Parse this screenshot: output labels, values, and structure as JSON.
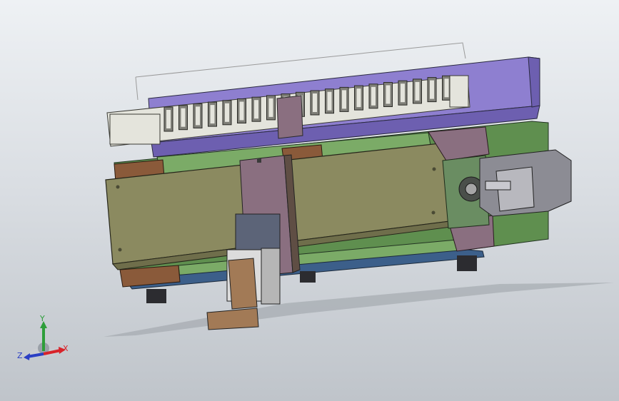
{
  "viewport": {
    "background_top": "#eef1f4",
    "background_bottom": "#bfc4ca"
  },
  "model": {
    "colors": {
      "purple_plate": "#8e7fd0",
      "purple_dark": "#6d5fb0",
      "chain": "#e4e4dc",
      "chain_dark": "#7f7f78",
      "olive_body": "#8b8a60",
      "olive_dark": "#6f6e4b",
      "green_plate": "#5f8f4f",
      "green_light": "#7bab67",
      "brown": "#8a5a3a",
      "mauve_bracket": "#8a6f80",
      "motor_grey": "#8c8c94",
      "mount_green": "#6a8d62",
      "block_tan": "#a27a56"
    }
  },
  "triad": {
    "x_label": "X",
    "y_label": "Y",
    "z_label": "Z",
    "x_color": "#d8232a",
    "y_color": "#2e9e3a",
    "z_color": "#2b3fc4"
  }
}
